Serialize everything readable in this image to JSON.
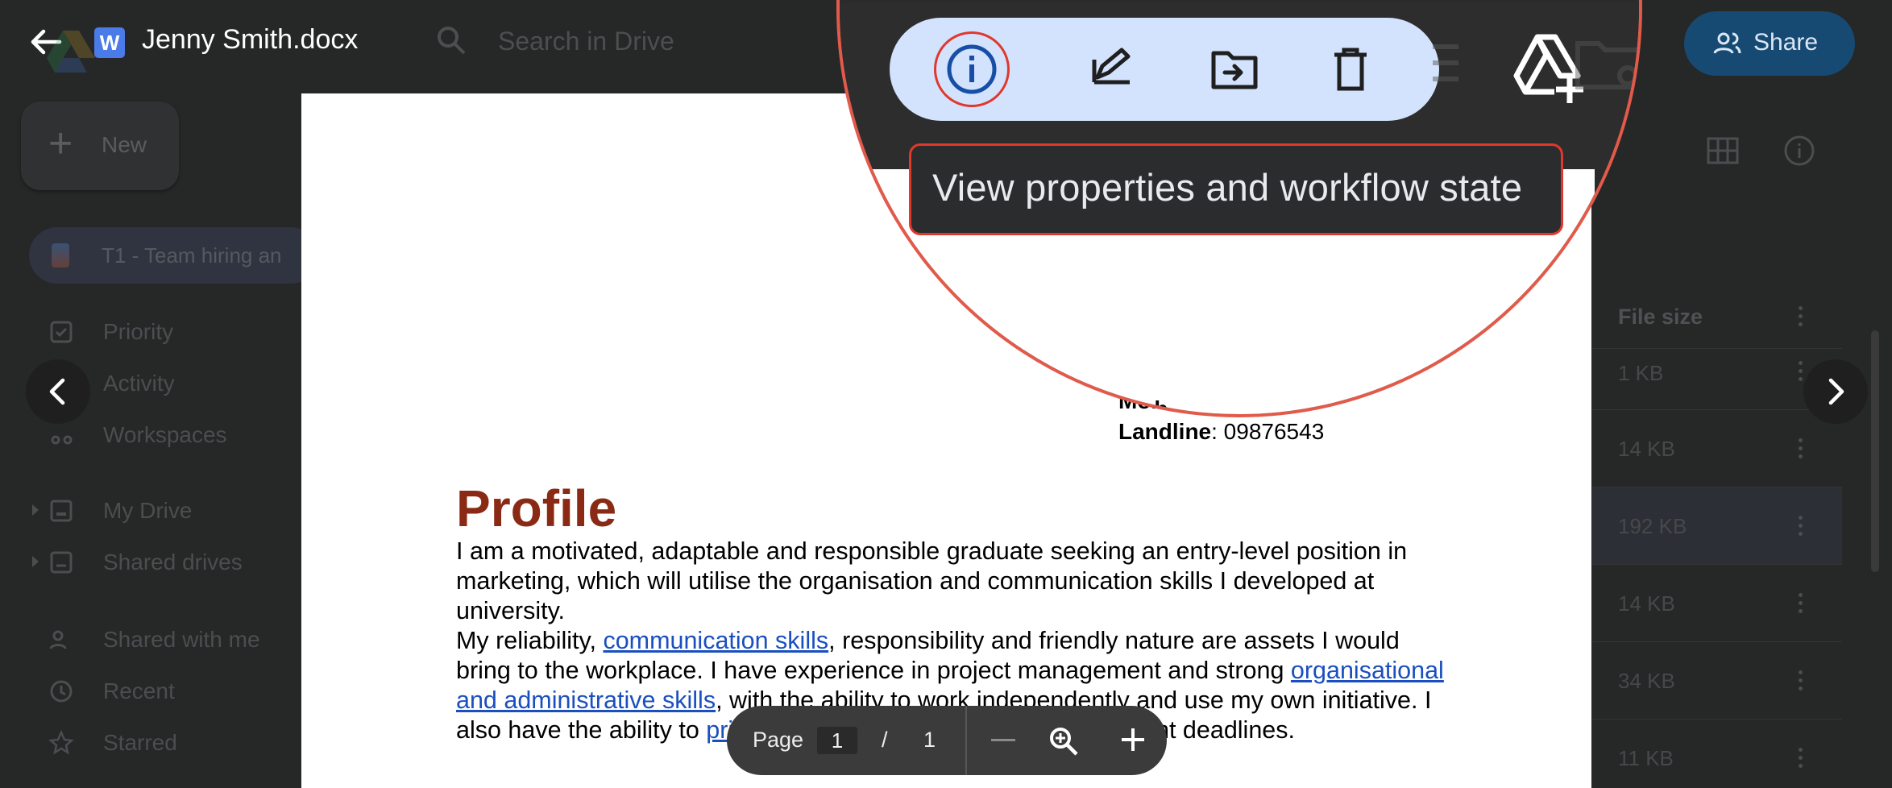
{
  "viewer": {
    "file_title": "Jenny Smith.docx",
    "file_type_badge": "W",
    "share_label": "Share"
  },
  "drive_background": {
    "search_placeholder": "Search in Drive",
    "new_button_label": "New",
    "workspace_chip": "T1 - Team hiring an",
    "sidebar": {
      "items": [
        {
          "label": "Priority",
          "icon": "priority-icon"
        },
        {
          "label": "Activity",
          "icon": "activity-icon"
        },
        {
          "label": "Workspaces",
          "icon": "workspaces-icon"
        },
        {
          "label": "My Drive",
          "icon": "my-drive-icon"
        },
        {
          "label": "Shared drives",
          "icon": "shared-drives-icon"
        },
        {
          "label": "Shared with me",
          "icon": "shared-with-me-icon"
        },
        {
          "label": "Recent",
          "icon": "clock-icon"
        },
        {
          "label": "Starred",
          "icon": "star-icon"
        }
      ]
    },
    "file_size_header": "File size",
    "file_sizes": [
      "1 KB",
      "14 KB",
      "192 KB",
      "14 KB",
      "34 KB",
      "11 KB"
    ]
  },
  "document": {
    "contact_partial": "Mob",
    "landline_label": "Landline",
    "landline_value": ": 09876543",
    "profile_heading": "Profile",
    "para1": "I am a motivated, adaptable and responsible graduate seeking an entry-level position in marketing, which will utilise the organisation and communication skills I developed at university.",
    "para2_a": "My reliability, ",
    "para2_link1": "communication skills",
    "para2_b": ", responsibility and friendly nature are assets I would bring to the workplace. I have experience in project management and strong ",
    "para2_link2": "organisational and administrative skills",
    "para2_c": ", with the ability to work independently and use my own initiative. I also have the ability to ",
    "para2_link3": "prioritise",
    "para2_d": " while under pressure to meet tight deadlines."
  },
  "page_toolbar": {
    "page_label": "Page",
    "current_page": "1",
    "separator": "/",
    "total_pages": "1"
  },
  "callout": {
    "tooltip": "View properties and workflow state",
    "actions": [
      {
        "icon": "info-icon",
        "highlighted": true
      },
      {
        "icon": "edit-icon"
      },
      {
        "icon": "move-to-folder-icon"
      },
      {
        "icon": "trash-icon"
      }
    ],
    "highlight_color": "#e0382d",
    "pill_color": "#d3e3fd"
  }
}
